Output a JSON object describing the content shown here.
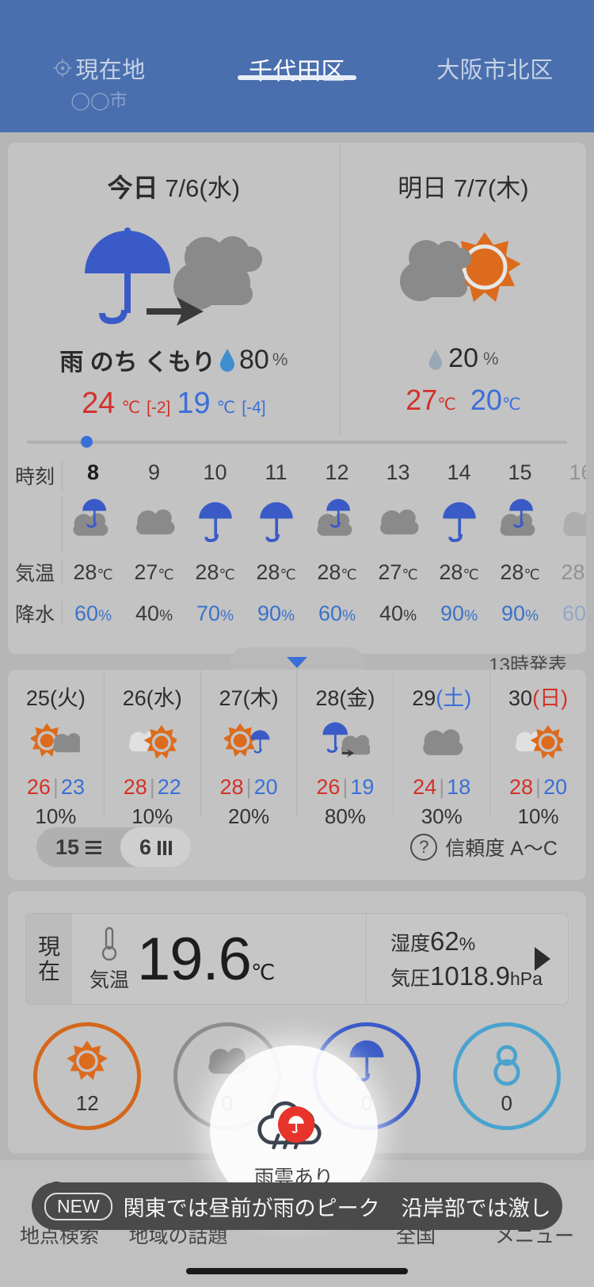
{
  "header": {
    "tabs": [
      {
        "label": "現在地",
        "sublabel": "◯◯市",
        "icon": "gps-icon",
        "active": false
      },
      {
        "label": "千代田区",
        "sublabel": "",
        "icon": "",
        "active": true
      },
      {
        "label": "大阪市北区",
        "sublabel": "",
        "icon": "",
        "active": false
      }
    ],
    "accent_color": "#4a6fae"
  },
  "today_card": {
    "today": {
      "day_label": "今日",
      "date": "7/6(水)",
      "icon": "rain-then-cloudy-icon",
      "condition": "雨 のち くもり",
      "pop": "80",
      "pop_unit": "%",
      "temp_high": "24",
      "temp_high_unit": "℃",
      "temp_high_delta": "[-2]",
      "temp_low": "19",
      "temp_low_unit": "℃",
      "temp_low_delta": "[-4]"
    },
    "tomorrow": {
      "day_label": "明日",
      "date": "7/7(木)",
      "icon": "cloudy-then-sunny-icon",
      "pop": "20",
      "pop_unit": "%",
      "temp_high": "27",
      "temp_high_unit": "℃",
      "temp_low": "20",
      "temp_low_unit": "℃"
    },
    "hourly": {
      "row_labels": {
        "time": "時刻",
        "temp": "気温",
        "precip": "降水"
      },
      "current_hour_index": 0,
      "hours": [
        {
          "time": "8",
          "icon": "cloudy-rain-icon",
          "temp": "28",
          "temp_unit": "℃",
          "pop": "60",
          "pop_unit": "%",
          "pop_blue": true
        },
        {
          "time": "9",
          "icon": "cloudy-icon",
          "temp": "27",
          "temp_unit": "℃",
          "pop": "40",
          "pop_unit": "%",
          "pop_blue": false
        },
        {
          "time": "10",
          "icon": "rain-icon",
          "temp": "28",
          "temp_unit": "℃",
          "pop": "70",
          "pop_unit": "%",
          "pop_blue": true
        },
        {
          "time": "11",
          "icon": "rain-icon",
          "temp": "28",
          "temp_unit": "℃",
          "pop": "90",
          "pop_unit": "%",
          "pop_blue": true
        },
        {
          "time": "12",
          "icon": "cloudy-rain-icon",
          "temp": "28",
          "temp_unit": "℃",
          "pop": "60",
          "pop_unit": "%",
          "pop_blue": true
        },
        {
          "time": "13",
          "icon": "cloudy-icon",
          "temp": "27",
          "temp_unit": "℃",
          "pop": "40",
          "pop_unit": "%",
          "pop_blue": false
        },
        {
          "time": "14",
          "icon": "rain-icon",
          "temp": "28",
          "temp_unit": "℃",
          "pop": "90",
          "pop_unit": "%",
          "pop_blue": true
        },
        {
          "time": "15",
          "icon": "cloudy-rain-icon",
          "temp": "28",
          "temp_unit": "℃",
          "pop": "90",
          "pop_unit": "%",
          "pop_blue": true
        }
      ],
      "expand_icon": "chevron-down-icon",
      "issued_text": "13時発表"
    }
  },
  "week_card": {
    "days": [
      {
        "date": "25",
        "dow": "(火)",
        "dow_kind": "weekday",
        "icon": "sunny-cloudy-icon",
        "high": "26",
        "low": "23",
        "pop": "10%"
      },
      {
        "date": "26",
        "dow": "(水)",
        "dow_kind": "weekday",
        "icon": "cloudy-sunny-icon",
        "high": "28",
        "low": "22",
        "pop": "10%"
      },
      {
        "date": "27",
        "dow": "(木)",
        "dow_kind": "weekday",
        "icon": "sunny-rain-icon",
        "high": "28",
        "low": "20",
        "pop": "20%"
      },
      {
        "date": "28",
        "dow": "(金)",
        "dow_kind": "weekday",
        "icon": "rain-cloudy-icon",
        "high": "26",
        "low": "19",
        "pop": "80%"
      },
      {
        "date": "29",
        "dow": "(土)",
        "dow_kind": "sat",
        "icon": "cloudy-icon",
        "high": "24",
        "low": "18",
        "pop": "30%"
      },
      {
        "date": "30",
        "dow": "(日)",
        "dow_kind": "sun",
        "icon": "cloudy-sunny-icon",
        "high": "28",
        "low": "20",
        "pop": "10%"
      }
    ],
    "toggle": {
      "option_15": "15",
      "option_6": "6",
      "selected": "6"
    },
    "confidence": {
      "icon": "question-icon",
      "label": "信頼度 A〜C"
    }
  },
  "now_card": {
    "badge_line1": "現",
    "badge_line2": "在",
    "temp_icon": "thermometer-icon",
    "temp_label": "気温",
    "temp_value": "19.6",
    "temp_unit": "℃",
    "humidity_label": "湿度",
    "humidity_value": "62",
    "humidity_unit": "%",
    "pressure_label": "気圧",
    "pressure_value": "1018.9",
    "pressure_unit": "hPa",
    "arrow_icon": "chevron-right-icon",
    "circles": [
      {
        "icon": "sunny-icon",
        "color": "#d4671b",
        "value": "12"
      },
      {
        "icon": "cloudy-icon",
        "color": "#8d8d8d",
        "value": "0"
      },
      {
        "icon": "rain-icon",
        "color": "#3a5bc7",
        "value": "0"
      },
      {
        "icon": "snow-icon",
        "color": "#4aa3cf",
        "value": "0"
      }
    ]
  },
  "bottom_nav": {
    "items": [
      {
        "label": "地点検索",
        "icon": "search-icon",
        "active": false,
        "badge": ""
      },
      {
        "label": "地域の話題",
        "icon": "rss-icon",
        "active": false,
        "badge": ""
      },
      {
        "label": "雨雲あり",
        "icon": "rain-cloud-icon",
        "active": true,
        "badge": "umbrella-badge"
      },
      {
        "label": "全国",
        "icon": "chart-icon",
        "active": false,
        "badge": ""
      },
      {
        "label": "メニュー",
        "icon": "dots-icon",
        "active": false,
        "badge": ""
      }
    ]
  },
  "news_banner": {
    "tag": "NEW",
    "text": "関東では昼前が雨のピーク　沿岸部では激しい雨の…"
  }
}
